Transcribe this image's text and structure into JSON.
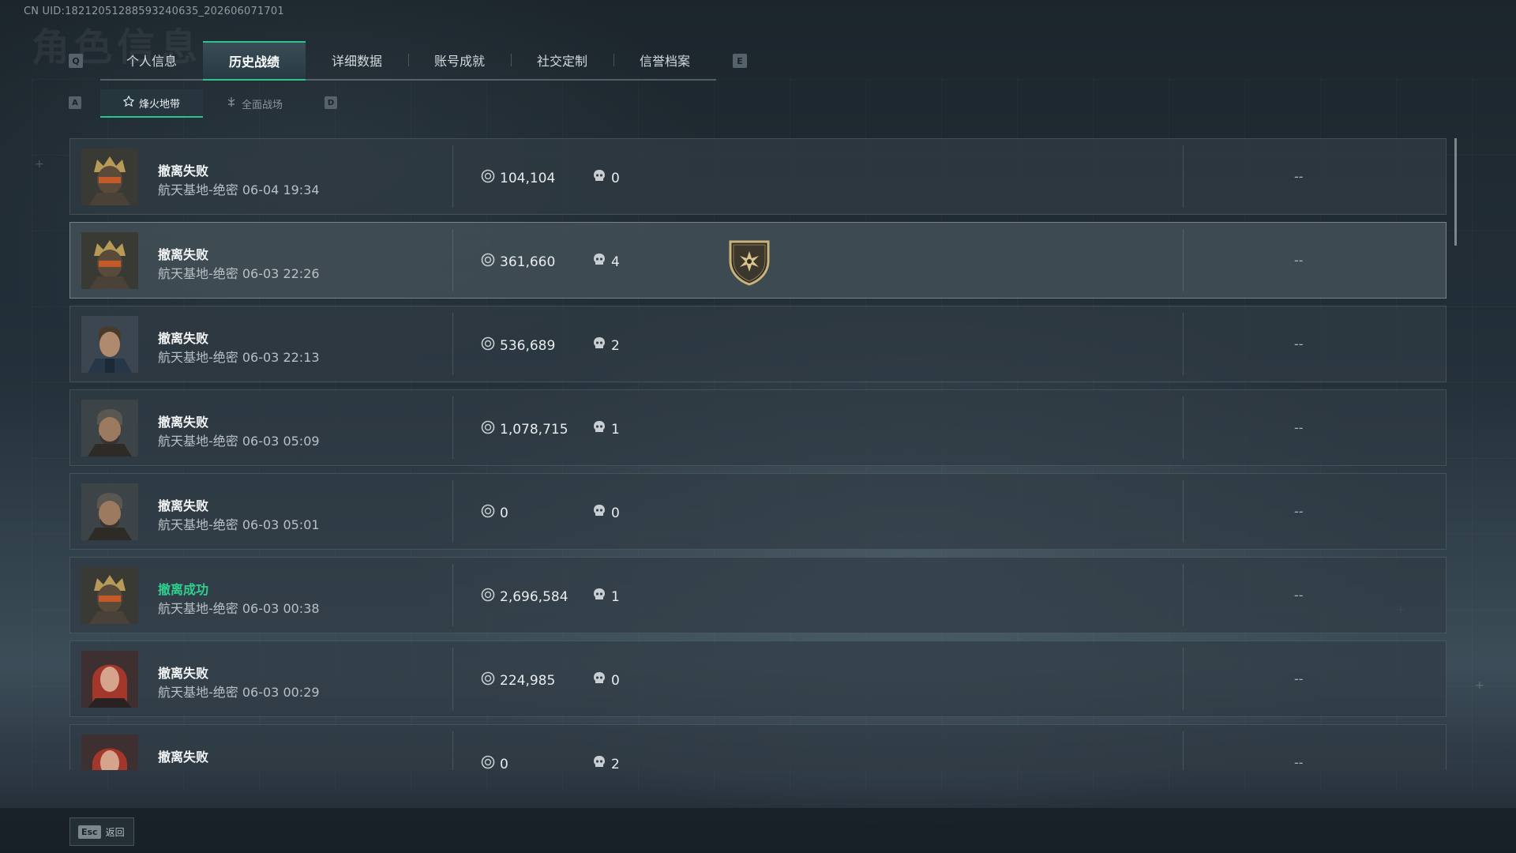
{
  "header": {
    "uid": "CN UID:1821205128859324063​5_202606071701",
    "watermark": "角色信息"
  },
  "keys": {
    "prev_tab": "Q",
    "next_tab": "E",
    "prev_sub": "A",
    "next_sub": "D"
  },
  "tabs": [
    {
      "label": "个人信息"
    },
    {
      "label": "历史战绩"
    },
    {
      "label": "详细数据"
    },
    {
      "label": "账号成就"
    },
    {
      "label": "社交定制"
    },
    {
      "label": "信誉档案"
    }
  ],
  "subtabs": [
    {
      "label": "烽火地带"
    },
    {
      "label": "全面战场"
    }
  ],
  "records": [
    {
      "result": "撤离失败",
      "map": "航天基地-绝密 06-04 19:34",
      "value": "104,104",
      "kills": "0",
      "extra": "--"
    },
    {
      "result": "撤离失败",
      "map": "航天基地-绝密 06-03 22:26",
      "value": "361,660",
      "kills": "4",
      "extra": "--"
    },
    {
      "result": "撤离失败",
      "map": "航天基地-绝密 06-03 22:13",
      "value": "536,689",
      "kills": "2",
      "extra": "--"
    },
    {
      "result": "撤离失败",
      "map": "航天基地-绝密 06-03 05:09",
      "value": "1,078,715",
      "kills": "1",
      "extra": "--"
    },
    {
      "result": "撤离失败",
      "map": "航天基地-绝密 06-03 05:01",
      "value": "0",
      "kills": "0",
      "extra": "--"
    },
    {
      "result": "撤离成功",
      "map": "航天基地-绝密 06-03 00:38",
      "value": "2,696,584",
      "kills": "1",
      "extra": "--"
    },
    {
      "result": "撤离失败",
      "map": "航天基地-绝密 06-03 00:29",
      "value": "224,985",
      "kills": "0",
      "extra": "--"
    },
    {
      "result": "撤离失败",
      "map": "",
      "value": "0",
      "kills": "2",
      "extra": "--"
    }
  ],
  "footer": {
    "esc_key": "Esc",
    "back_label": "返回"
  },
  "colors": {
    "accent": "#2fc28a",
    "success": "#2fd08f"
  }
}
